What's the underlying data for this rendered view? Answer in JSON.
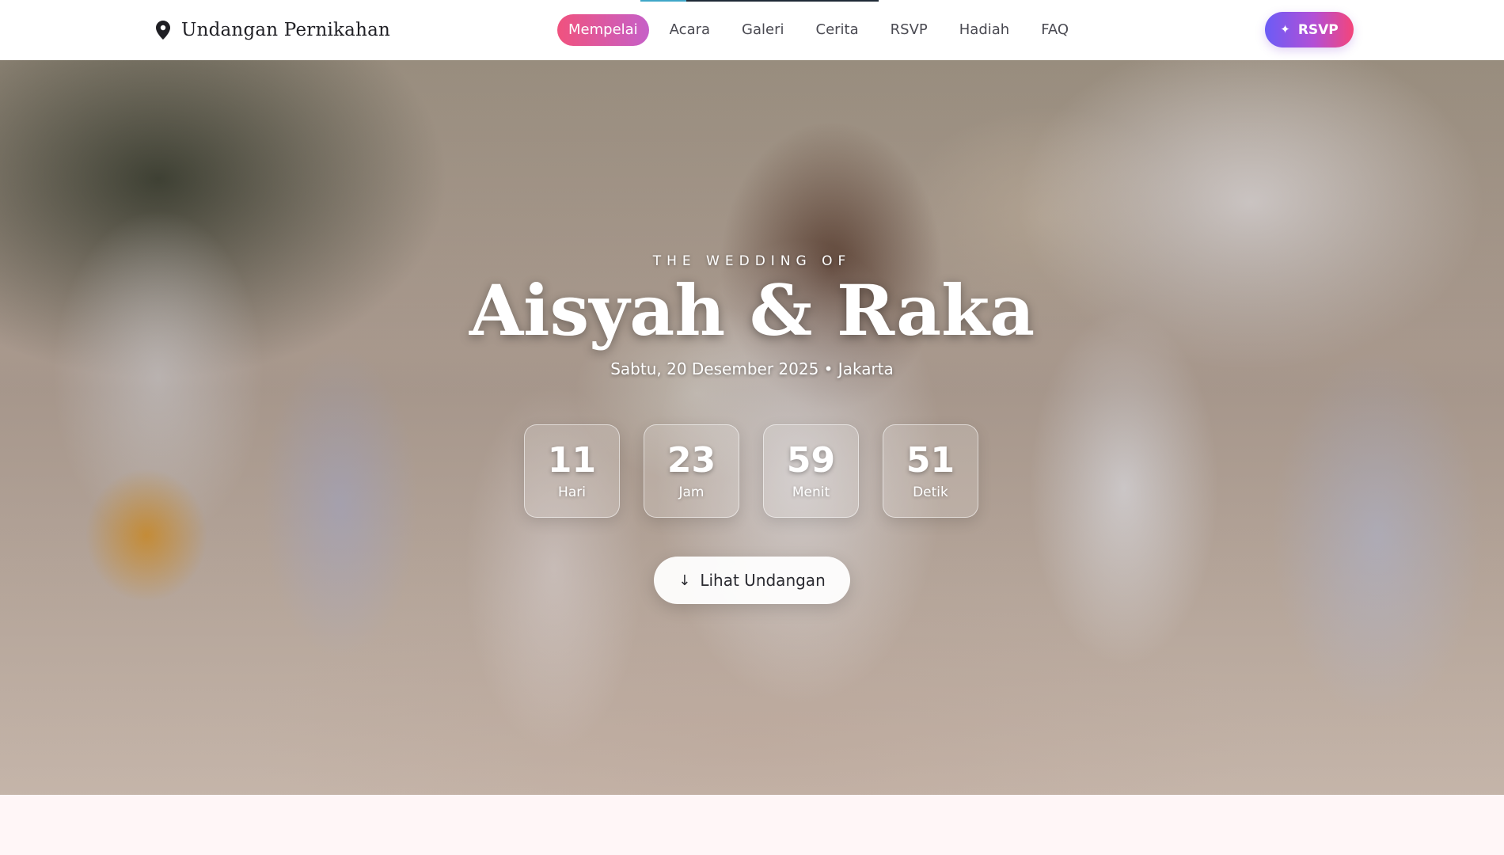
{
  "brand": {
    "title": "Undangan Pernikahan",
    "icon": "map-pin-icon"
  },
  "nav": {
    "items": [
      {
        "label": "Mempelai",
        "active": true
      },
      {
        "label": "Acara",
        "active": false
      },
      {
        "label": "Galeri",
        "active": false
      },
      {
        "label": "Cerita",
        "active": false
      },
      {
        "label": "RSVP",
        "active": false
      },
      {
        "label": "Hadiah",
        "active": false
      },
      {
        "label": "FAQ",
        "active": false
      }
    ],
    "cta": {
      "label": "RSVP",
      "icon": "sparkle-icon"
    }
  },
  "hero": {
    "kicker": "THE WEDDING OF",
    "couple": "Aisyah & Raka",
    "subline": "Sabtu, 20 Desember 2025 • Jakarta",
    "countdown": [
      {
        "value": "11",
        "label": "Hari"
      },
      {
        "value": "23",
        "label": "Jam"
      },
      {
        "value": "59",
        "label": "Menit"
      },
      {
        "value": "51",
        "label": "Detik"
      }
    ],
    "cta": {
      "label": "Lihat Undangan",
      "icon": "arrow-down-icon"
    }
  },
  "colors": {
    "accent_pink": "#f0527e",
    "accent_violet": "#6b5cf6",
    "page_background": "#fff6f7"
  }
}
